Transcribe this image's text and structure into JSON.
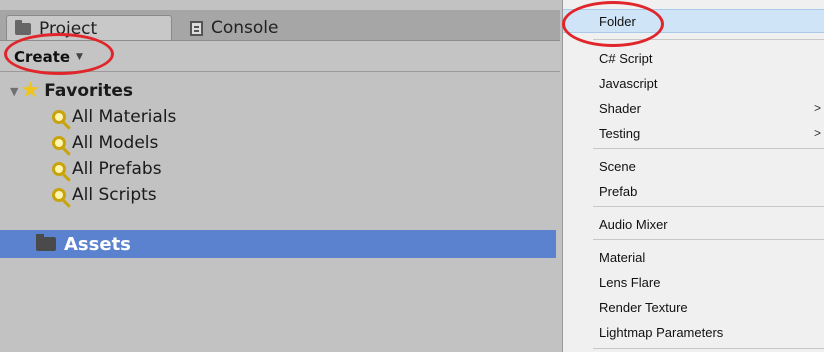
{
  "tabs": [
    {
      "label": "Project",
      "icon": "folder-icon"
    },
    {
      "label": "Console",
      "icon": "console-icon"
    }
  ],
  "toolbar": {
    "create_label": "Create"
  },
  "favorites": {
    "label": "Favorites",
    "items": [
      {
        "label": "All Materials"
      },
      {
        "label": "All Models"
      },
      {
        "label": "All Prefabs"
      },
      {
        "label": "All Scripts"
      }
    ]
  },
  "assets": {
    "label": "Assets"
  },
  "menu": {
    "items": [
      {
        "label": "Folder",
        "selected": true
      },
      {
        "label": "C# Script"
      },
      {
        "label": "Javascript"
      },
      {
        "label": "Shader",
        "submenu": true
      },
      {
        "label": "Testing",
        "submenu": true
      },
      {
        "label": "Scene"
      },
      {
        "label": "Prefab"
      },
      {
        "label": "Audio Mixer"
      },
      {
        "label": "Material"
      },
      {
        "label": "Lens Flare"
      },
      {
        "label": "Render Texture"
      },
      {
        "label": "Lightmap Parameters"
      }
    ],
    "submenu_arrow": ">"
  },
  "colors": {
    "selection": "#5b82cf",
    "menu_highlight": "#cfe4f7",
    "annotation_circle": "#e0262b",
    "star": "#f0c419"
  }
}
